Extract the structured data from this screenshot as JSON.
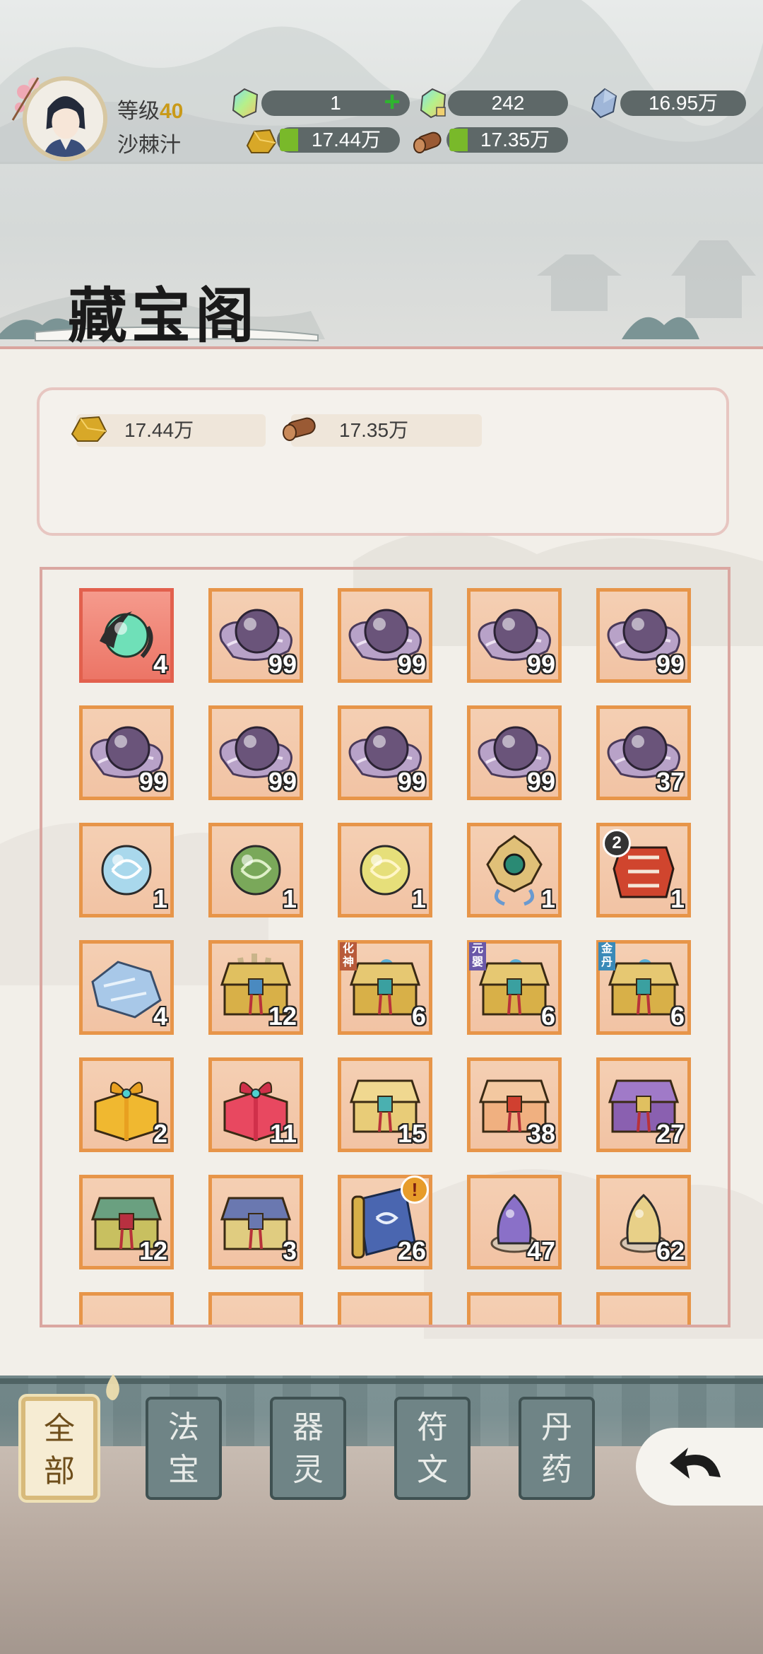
{
  "player": {
    "level_label": "等级",
    "level_value": "40",
    "name": "沙棘汁"
  },
  "resources": {
    "jade_premium": "1",
    "jade_bound": "242",
    "crystal": "16.95万",
    "gold": "17.44万",
    "wood": "17.35万"
  },
  "page_title": "藏宝阁",
  "shop_currency": {
    "gold": "17.44万",
    "wood": "17.35万"
  },
  "items": [
    {
      "icon": "jade-orb-icon",
      "qty": "4",
      "rare": true
    },
    {
      "icon": "purple-pearl-icon",
      "qty": "99"
    },
    {
      "icon": "purple-pearl-icon",
      "qty": "99"
    },
    {
      "icon": "purple-pearl-icon",
      "qty": "99"
    },
    {
      "icon": "purple-pearl-icon",
      "qty": "99"
    },
    {
      "icon": "purple-pearl-icon",
      "qty": "99"
    },
    {
      "icon": "purple-pearl-icon",
      "qty": "99"
    },
    {
      "icon": "purple-pearl-icon",
      "qty": "99"
    },
    {
      "icon": "purple-pearl-icon",
      "qty": "99"
    },
    {
      "icon": "purple-pearl-icon",
      "qty": "37"
    },
    {
      "icon": "blue-orb-icon",
      "qty": "1"
    },
    {
      "icon": "green-orb-icon",
      "qty": "1"
    },
    {
      "icon": "yellow-orb-icon",
      "qty": "1"
    },
    {
      "icon": "jade-pendant-icon",
      "qty": "1"
    },
    {
      "icon": "red-armor-icon",
      "qty": "1",
      "badge": "2"
    },
    {
      "icon": "blue-cloth-icon",
      "qty": "4"
    },
    {
      "icon": "scroll-chest-icon",
      "qty": "12"
    },
    {
      "icon": "treasure-chest-icon",
      "qty": "6",
      "tag": "化神"
    },
    {
      "icon": "treasure-chest-icon",
      "qty": "6",
      "tag": "元婴"
    },
    {
      "icon": "treasure-chest-icon",
      "qty": "6",
      "tag": "金丹"
    },
    {
      "icon": "gold-gift-box-icon",
      "qty": "2"
    },
    {
      "icon": "red-gift-box-icon",
      "qty": "11"
    },
    {
      "icon": "gold-chest-icon",
      "qty": "15"
    },
    {
      "icon": "red-gold-chest-icon",
      "qty": "38"
    },
    {
      "icon": "purple-chest-icon",
      "qty": "27"
    },
    {
      "icon": "green-chest-icon",
      "qty": "12"
    },
    {
      "icon": "blue-chest-icon",
      "qty": "3"
    },
    {
      "icon": "scroll-icon",
      "qty": "26",
      "alert": "!"
    },
    {
      "icon": "purple-stone-icon",
      "qty": "47"
    },
    {
      "icon": "gold-stone-icon",
      "qty": "62"
    }
  ],
  "tabs": [
    {
      "label": "全部",
      "active": true
    },
    {
      "label": "法宝"
    },
    {
      "label": "器灵"
    },
    {
      "label": "符文"
    },
    {
      "label": "丹药"
    }
  ],
  "colors": {
    "slot_bg": "#f4cfb3",
    "slot_border": "#e79549",
    "rare_bg": "#ec7566",
    "panel_border": "#daa7a1",
    "tab_bg": "#6f8486",
    "tab_active_bg": "#f6ecd3"
  }
}
